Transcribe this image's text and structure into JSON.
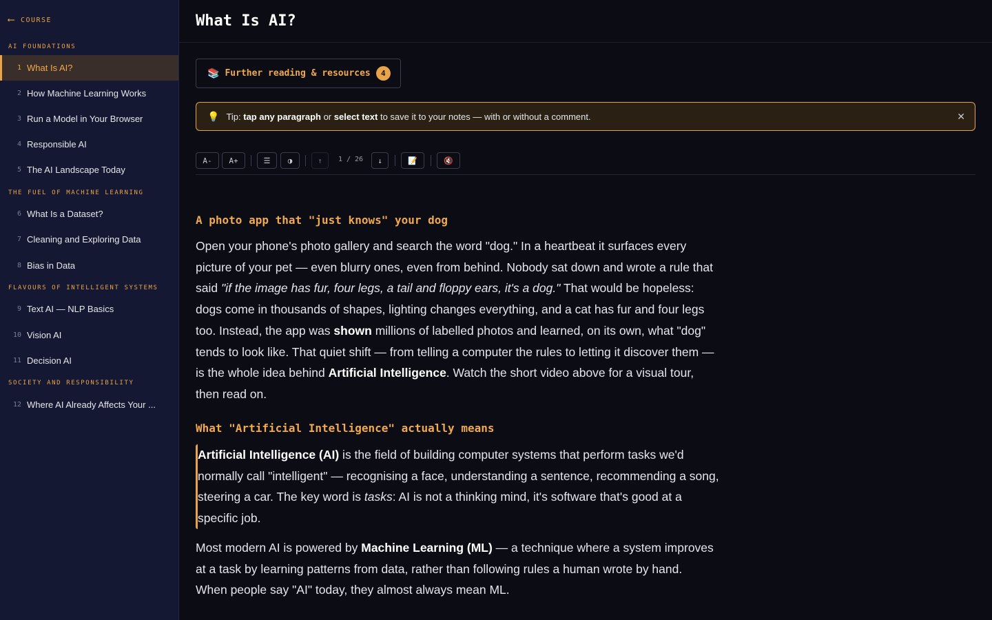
{
  "sidebar": {
    "back_label": "COURSE",
    "sections": [
      {
        "title": "AI FOUNDATIONS",
        "items": [
          {
            "num": "1",
            "label": "What Is AI?",
            "active": true
          },
          {
            "num": "2",
            "label": "How Machine Learning Works"
          },
          {
            "num": "3",
            "label": "Run a Model in Your Browser"
          },
          {
            "num": "4",
            "label": "Responsible AI"
          },
          {
            "num": "5",
            "label": "The AI Landscape Today"
          }
        ]
      },
      {
        "title": "THE FUEL OF MACHINE LEARNING",
        "items": [
          {
            "num": "6",
            "label": "What Is a Dataset?"
          },
          {
            "num": "7",
            "label": "Cleaning and Exploring Data"
          },
          {
            "num": "8",
            "label": "Bias in Data"
          }
        ]
      },
      {
        "title": "FLAVOURS OF INTELLIGENT SYSTEMS",
        "items": [
          {
            "num": "9",
            "label": "Text AI — NLP Basics"
          },
          {
            "num": "10",
            "label": "Vision AI"
          },
          {
            "num": "11",
            "label": "Decision AI"
          }
        ]
      },
      {
        "title": "SOCIETY AND RESPONSIBILITY",
        "items": [
          {
            "num": "12",
            "label": "Where AI Already Affects Your ..."
          }
        ]
      }
    ]
  },
  "header": {
    "title": "What Is AI?"
  },
  "resources": {
    "label": "Further reading & resources",
    "count": "4",
    "icon": "books-icon"
  },
  "tip": {
    "prefix": "Tip: ",
    "bold1": "tap any paragraph",
    "mid": " or ",
    "bold2": "select text",
    "suffix": " to save it to your notes — with or without a comment."
  },
  "toolbar": {
    "font_smaller": "A-",
    "font_larger": "A+",
    "list_icon": "☰",
    "contrast_icon": "◑",
    "up_icon": "↑",
    "position": "1 / 26",
    "down_icon": "↓",
    "notes_icon": "📝",
    "mute_icon": "🔇"
  },
  "article": {
    "h1": "A photo app that \"just knows\" your dog",
    "p1": {
      "a": "Open your phone's photo gallery and search the word \"dog.\" In a heartbeat it surfaces every picture of your pet — even blurry ones, even from behind. Nobody sat down and wrote a rule that said ",
      "i": "\"if the image has fur, four legs, a tail and floppy ears, it's a dog.\"",
      "b": " That would be hopeless: dogs come in thousands of shapes, lighting changes everything, and a cat has fur and four legs too. Instead, the app was ",
      "bold1": "shown",
      "c": " millions of labelled photos and learned, on its own, what \"dog\" tends to look like. That quiet shift — from telling a computer the rules to letting it discover them — is the whole idea behind ",
      "bold2": "Artificial Intelligence",
      "d": ". Watch the short video above for a visual tour, then read on."
    },
    "h2": "What \"Artificial Intelligence\" actually means",
    "p2": {
      "bold": "Artificial Intelligence (AI)",
      "a": " is the field of building computer systems that perform tasks we'd normally call \"intelligent\" — recognising a face, understanding a sentence, recommending a song, steering a car. The key word is ",
      "i": "tasks",
      "b": ": AI is not a thinking mind, it's software that's good at a specific job."
    },
    "p3": {
      "a": "Most modern AI is powered by ",
      "bold": "Machine Learning (ML)",
      "b": " — a technique where a system improves at a task by learning patterns from data, rather than following rules a human wrote by hand. When people say \"AI\" today, they almost always mean ML."
    }
  }
}
